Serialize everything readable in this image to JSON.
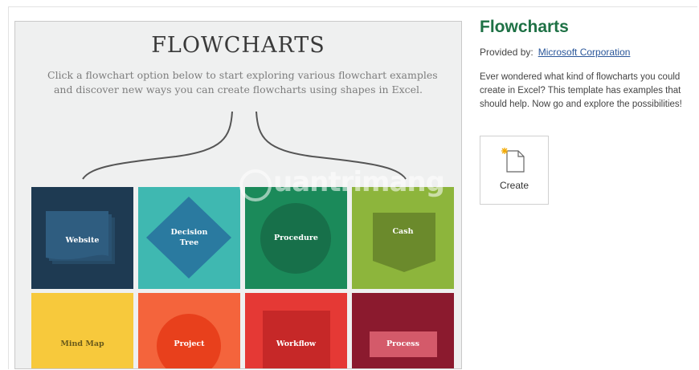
{
  "preview": {
    "title": "FLOWCHARTS",
    "desc_line1": "Click a flowchart option below to start exploring various flowchart examples",
    "desc_line2": "and discover new ways you can create flowcharts using shapes in Excel.",
    "tiles": [
      {
        "label": "Website",
        "bg": "#1e3a52"
      },
      {
        "label": "Decision Tree",
        "label_line1": "Decision",
        "label_line2": "Tree",
        "bg": "#3fb8b1"
      },
      {
        "label": "Procedure",
        "bg": "#1b8a5a"
      },
      {
        "label": "Cash",
        "bg": "#8db53c"
      },
      {
        "label": "Mind Map",
        "bg": "#f7c93c"
      },
      {
        "label": "Project",
        "bg": "#f4643c"
      },
      {
        "label": "Workflow",
        "bg": "#e53935"
      },
      {
        "label": "Process",
        "bg": "#8b1a2e"
      }
    ]
  },
  "details": {
    "title": "Flowcharts",
    "provided_by_label": "Provided by:",
    "provider": "Microsoft Corporation",
    "desc_line1": "Ever wondered what kind of flowcharts you could",
    "desc_line2": "create in Excel? This template has examples that",
    "desc_line3": "should help. Now go and explore the possibilities!",
    "create_label": "Create"
  },
  "watermark": {
    "text": "uantrimang"
  },
  "colors": {
    "title_green": "#1e7145",
    "link_blue": "#2b579a"
  }
}
